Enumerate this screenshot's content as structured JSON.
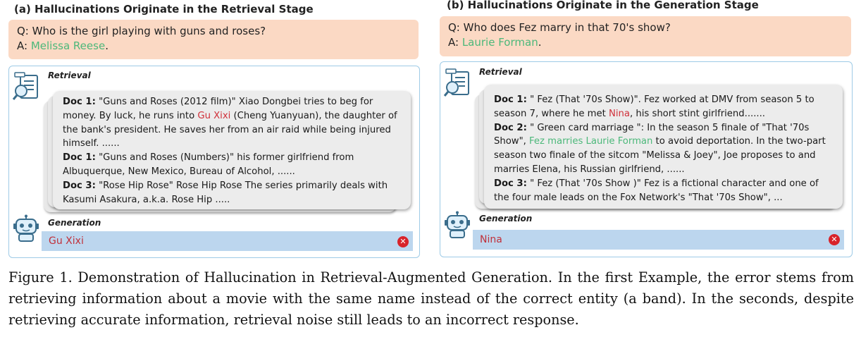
{
  "panel_a": {
    "title": "(a) Hallucinations Originate in the Retrieval Stage",
    "question": "Q: Who is the girl playing with guns and roses?",
    "answer_prefix": "A: ",
    "answer": "Melissa Reese",
    "answer_suffix": ".",
    "retrieval_label": "Retrieval",
    "docs": [
      {
        "label": "Doc 1:",
        "pre": " \"Guns and Roses (2012 film)\" Xiao Dongbei tries to beg for money. By luck, he runs into ",
        "hl": "Gu Xixi",
        "post": " (Cheng Yuanyuan), the daughter of the bank's president. He saves her from an air raid while being injured himself. ......"
      },
      {
        "label": "Doc 1:",
        "pre": " \"Guns and Roses (Numbers)\" his former girlfriend from Albuquerque, New Mexico, Bureau of Alcohol, ......",
        "hl": "",
        "post": ""
      },
      {
        "label": "Doc 3:",
        "pre": " \"Rose Hip Rose\" Rose Hip Rose The series primarily deals with Kasumi Asakura, a.k.a. Rose Hip .....",
        "hl": "",
        "post": ""
      }
    ],
    "generation_label": "Generation",
    "generation": "Gu Xixi"
  },
  "panel_b": {
    "title": "(b) Hallucinations Originate in the Generation Stage",
    "question": "Q: Who does Fez marry in that 70's show?",
    "answer_prefix": "A: ",
    "answer": "Laurie Forman",
    "answer_suffix": ".",
    "retrieval_label": "Retrieval",
    "docs": [
      {
        "label": "Doc 1:",
        "pre": " \" Fez (That '70s Show)\". Fez worked at DMV from season 5 to season 7, where he met ",
        "hl": "Nina",
        "post": ", his short stint girlfriend......."
      },
      {
        "label": "Doc 2:",
        "pre": " \" Green card marriage \": In the season 5 finale of \"That '70s Show\", ",
        "hl": "Fez marries Laurie Forman",
        "post": " to avoid deportation. In the two-part season two finale of the sitcom \"Melissa & Joey\", Joe proposes to and marries Elena, his Russian girlfriend, ......"
      },
      {
        "label": "Doc 3:",
        "pre": " \" Fez (That '70s Show )\" Fez is a fictional character and one of the four male leads on the Fox Network's \"That '70s Show\", ...",
        "hl": "",
        "post": ""
      }
    ],
    "generation_label": "Generation",
    "generation": "Nina"
  },
  "icons": {
    "retrieval": "document-magnifier-icon",
    "generation": "robot-icon",
    "error": "error-x-icon"
  },
  "colors": {
    "qa_background": "#fbd9c4",
    "correct_answer": "#4cb87a",
    "hallucination": "#d0303a",
    "generation_bar": "#bcd6ee",
    "panel_border": "#9ecbe6"
  },
  "caption": "Figure 1. Demonstration of Hallucination in Retrieval-Augmented Generation. In the first Example, the error stems from retrieving information about a movie with the same name instead of the correct entity (a band). In the seconds, despite retrieving accurate information, retrieval noise still leads to an incorrect response."
}
